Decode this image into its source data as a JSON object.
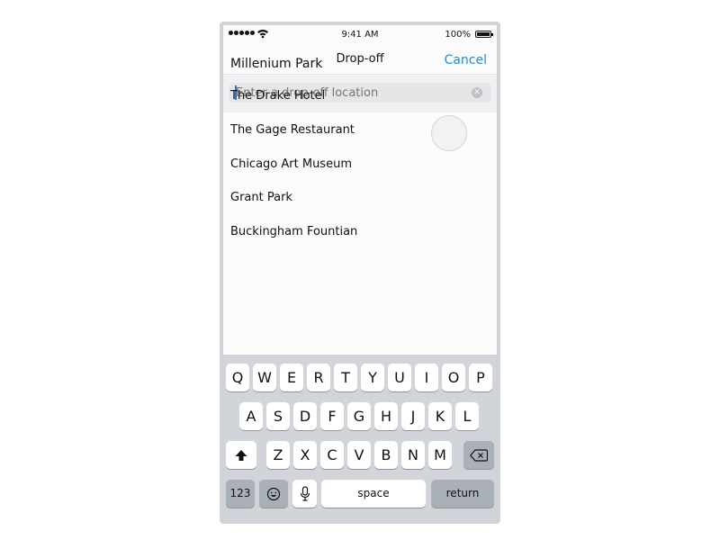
{
  "status_bar": {
    "time": "9:41 AM",
    "battery": "100%"
  },
  "nav": {
    "title": "Drop-off",
    "left_label": "Millenium Park",
    "cancel": "Cancel"
  },
  "search": {
    "placeholder": "Enter a drop-off location"
  },
  "locations": [
    "The Drake Hotel",
    "The Gage Restaurant",
    "Chicago Art Museum",
    "Grant Park",
    "Buckingham Fountian"
  ],
  "keyboard": {
    "row1": [
      "Q",
      "W",
      "E",
      "R",
      "T",
      "Y",
      "U",
      "I",
      "O",
      "P"
    ],
    "row2": [
      "A",
      "S",
      "D",
      "F",
      "G",
      "H",
      "J",
      "K",
      "L"
    ],
    "row3": [
      "Z",
      "X",
      "C",
      "V",
      "B",
      "N",
      "M"
    ],
    "numbers": "123",
    "space": "space",
    "return": "return"
  },
  "icons": [
    "wifi-icon",
    "battery-icon",
    "clear-icon",
    "shift-icon",
    "backspace-icon",
    "emoji-icon",
    "microphone-icon"
  ]
}
